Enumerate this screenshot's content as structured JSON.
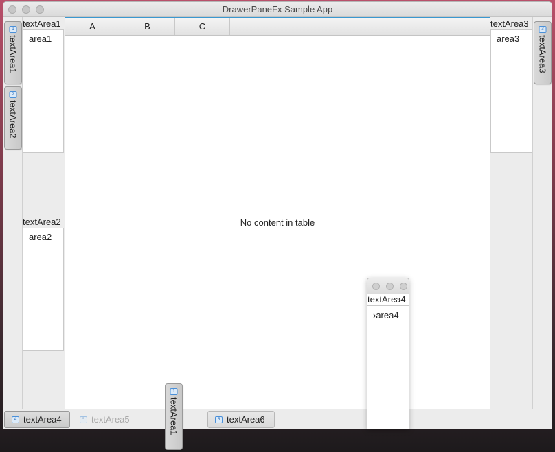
{
  "window": {
    "title": "DrawerPaneFx Sample App"
  },
  "left_tabs": [
    {
      "badge": "1",
      "label": "textArea1"
    },
    {
      "badge": "2",
      "label": "textArea2"
    }
  ],
  "right_tabs": [
    {
      "badge": "3",
      "label": "textArea3"
    }
  ],
  "drawers": {
    "area1": {
      "header": "textArea1",
      "content": "area1"
    },
    "area2": {
      "header": "textArea2",
      "content": "area2"
    },
    "area3": {
      "header": "textArea3",
      "content": "area3"
    }
  },
  "table": {
    "columns": [
      "A",
      "B",
      "C"
    ],
    "placeholder": "No content in table"
  },
  "bottom_tabs": [
    {
      "badge": "4",
      "label": "textArea4",
      "state": "active"
    },
    {
      "badge": "5",
      "label": "textArea5",
      "state": "disabled"
    },
    {
      "badge": "6",
      "label": "textArea6",
      "state": "normal"
    }
  ],
  "floating_window": {
    "header": "textArea4",
    "content": "›area4"
  },
  "floating_tab": {
    "badge": "1",
    "label": "textArea1"
  }
}
